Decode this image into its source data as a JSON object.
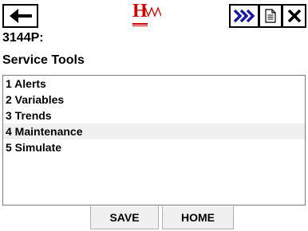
{
  "toolbar": {
    "back_icon": "left-arrow-icon",
    "logo_text": "H",
    "fast_key_icon": "triple-chevron-right-icon",
    "notes_icon": "document-icon",
    "close_icon": "close-icon",
    "accent_color": "#cc0000",
    "fast_key_color": "#1a1aa6"
  },
  "device": {
    "tag": "3144P:"
  },
  "section": {
    "title": "Service Tools"
  },
  "menu": {
    "items": [
      {
        "label": "1 Alerts"
      },
      {
        "label": "2 Variables"
      },
      {
        "label": "3 Trends"
      },
      {
        "label": "4 Maintenance",
        "selected": true
      },
      {
        "label": "5 Simulate"
      }
    ]
  },
  "buttons": {
    "save_label": "SAVE",
    "home_label": "HOME"
  }
}
